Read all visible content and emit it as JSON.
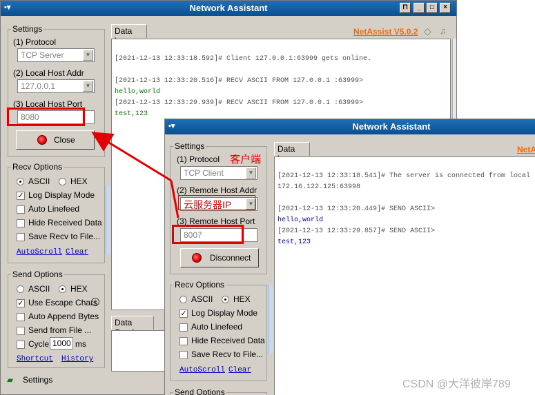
{
  "server_window": {
    "title": "Network Assistant",
    "brand": "NetAssist V5.0.2",
    "settings": {
      "title": "Settings",
      "protocol_label": "(1) Protocol",
      "protocol_value": "TCP Server",
      "host_addr_label": "(2) Local Host Addr",
      "host_addr_value": "127.0.0.1",
      "host_port_label": "(3) Local Host Port",
      "host_port_value": "8080",
      "action_label": "Close"
    },
    "recv_options": {
      "title": "Recv Options",
      "ascii": "ASCII",
      "hex": "HEX",
      "log_display": "Log Display Mode",
      "auto_linefeed": "Auto Linefeed",
      "hide_received": "Hide Received Data",
      "save_recv": "Save Recv to File...",
      "autoscroll": "AutoScroll",
      "clear": "Clear"
    },
    "send_options": {
      "title": "Send Options",
      "ascii": "ASCII",
      "hex": "HEX",
      "escape": "Use Escape Chars",
      "append": "Auto Append Bytes",
      "send_file": "Send from File ...",
      "cycle": "Cycle",
      "cycle_value": "1000",
      "cycle_unit": "ms",
      "shortcut": "Shortcut",
      "history": "History"
    },
    "tabs": {
      "data_log": "Data log",
      "data_send": "Data Send"
    },
    "status_settings": "Settings",
    "log": [
      {
        "kind": "ln",
        "text": "[2021-12-13 12:33:18.592]# Client 127.0.0.1:63999 gets online."
      },
      {
        "kind": "gap",
        "text": ""
      },
      {
        "kind": "ln",
        "text": "[2021-12-13 12:33:20.516]# RECV ASCII FROM 127.0.0.1 :63999>"
      },
      {
        "kind": "dt",
        "text": "hello,world"
      },
      {
        "kind": "ln",
        "text": "[2021-12-13 12:33:29.939]# RECV ASCII FROM 127.0.0.1 :63999>"
      },
      {
        "kind": "dt",
        "text": "test,123"
      }
    ]
  },
  "client_window": {
    "title": "Network Assistant",
    "brand": "NetA",
    "settings": {
      "title": "Settings",
      "protocol_label": "(1) Protocol",
      "protocol_value": "TCP Client",
      "remote_addr_label": "(2) Remote Host Addr",
      "remote_addr_value": "云服务器IP",
      "remote_port_label": "(3) Remote Host Port",
      "remote_port_value": "8007",
      "action_label": "Disconnect"
    },
    "recv_options": {
      "title": "Recv Options",
      "ascii": "ASCII",
      "hex": "HEX",
      "log_display": "Log Display Mode",
      "auto_linefeed": "Auto Linefeed",
      "hide_received": "Hide Received Data",
      "save_recv": "Save Recv to File...",
      "autoscroll": "AutoScroll",
      "clear": "Clear"
    },
    "send_options": {
      "title": "Send Options"
    },
    "tabs": {
      "data_log": "Data log"
    },
    "log": [
      {
        "kind": "ln",
        "text": "[2021-12-13 12:33:18.541]# The server is connected from local"
      },
      {
        "kind": "ln",
        "text": "172.16.122.125:63998"
      },
      {
        "kind": "gap",
        "text": ""
      },
      {
        "kind": "ln",
        "text": "[2021-12-13 12:33:20.449]# SEND ASCII>"
      },
      {
        "kind": "dt2",
        "text": "hello,world"
      },
      {
        "kind": "ln",
        "text": "[2021-12-13 12:33:29.857]# SEND ASCII>"
      },
      {
        "kind": "dt2",
        "text": "test,123"
      }
    ]
  },
  "annotation": {
    "client_label": "客户端"
  },
  "watermark": "CSDN @大洋彼岸789",
  "colors": {
    "annotation": "#e00000",
    "brand": "#ff6600",
    "titlebar": "#0a4f92"
  }
}
